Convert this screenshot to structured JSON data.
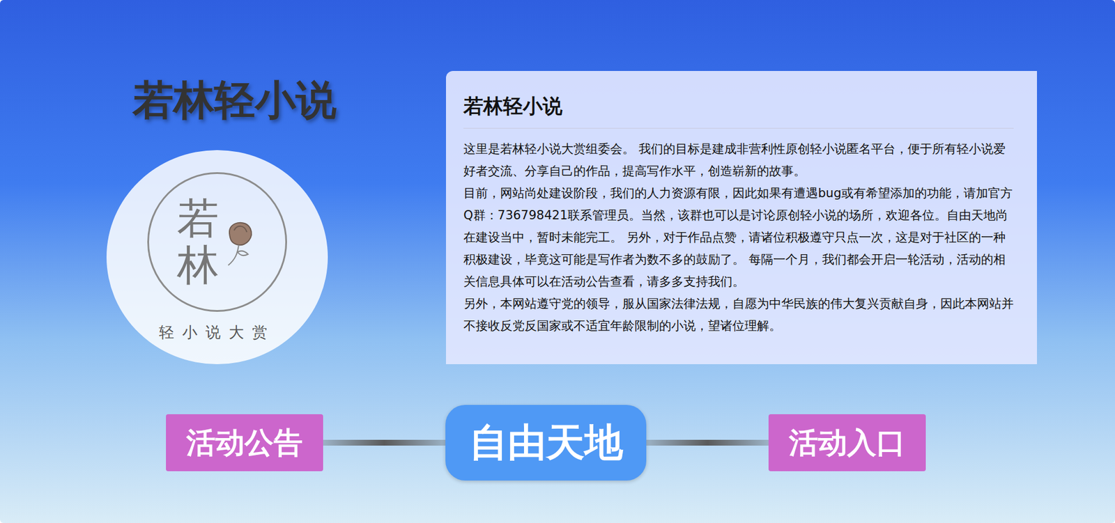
{
  "site_title": "若林轻小说",
  "logo": {
    "title": "若林",
    "subtitle": "轻小说大赏"
  },
  "notice": {
    "title": "若林轻小说",
    "paragraphs": [
      "这里是若林轻小说大赏组委会。 我们的目标是建成非营利性原创轻小说匿名平台，便于所有轻小说爱好者交流、分享自己的作品，提高写作水平，创造崭新的故事。",
      "目前，网站尚处建设阶段，我们的人力资源有限，因此如果有遭遇bug或有希望添加的功能，请加官方Q群：736798421联系管理员。当然，该群也可以是讨论原创轻小说的场所，欢迎各位。自由天地尚在建设当中，暂时未能完工。 另外，对于作品点赞，请诸位积极遵守只点一次，这是对于社区的一种积极建设，毕竟这可能是写作者为数不多的鼓励了。 每隔一个月，我们都会开启一轮活动，活动的相关信息具体可以在活动公告查看，请多多支持我们。",
      "另外，本网站遵守党的领导，服从国家法律法规，自愿为中华民族的伟大复兴贡献自身，因此本网站并不接收反党反国家或不适宜年龄限制的小说，望诸位理解。"
    ]
  },
  "nav": [
    {
      "label": "活动公告",
      "kind": "side"
    },
    {
      "label": "自由天地",
      "kind": "main"
    },
    {
      "label": "活动入口",
      "kind": "side"
    }
  ]
}
